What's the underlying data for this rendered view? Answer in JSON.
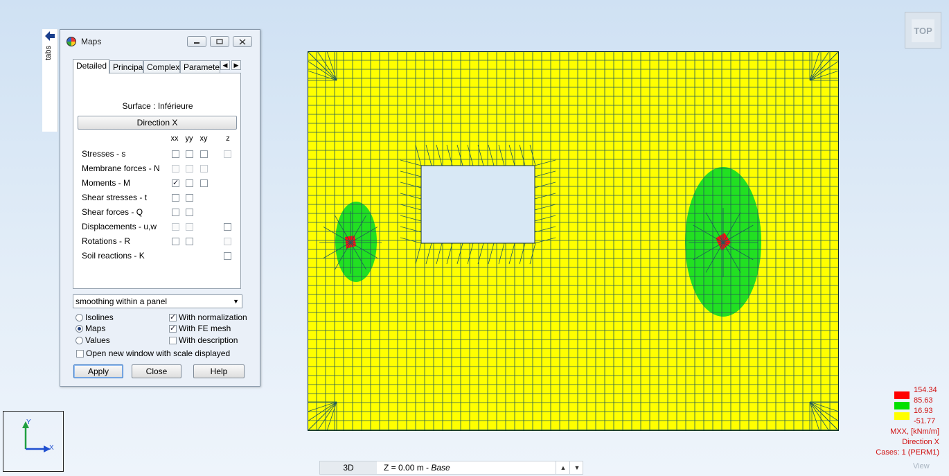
{
  "tabs_strip": {
    "label": "tabs"
  },
  "dialog": {
    "title": "Maps",
    "tabs": [
      {
        "label": "Detailed",
        "active": true
      },
      {
        "label": "Principal",
        "active": false
      },
      {
        "label": "Complex",
        "active": false
      },
      {
        "label": "Parameter",
        "active": false
      }
    ],
    "surface_label": "Surface : Inférieure",
    "direction_button": "Direction X",
    "columns": [
      "xx",
      "yy",
      "xy",
      "z"
    ],
    "rows": [
      {
        "label": "Stresses - s",
        "xx": "off",
        "yy": "off",
        "xy": "off",
        "z": "disabled"
      },
      {
        "label": "Membrane forces - N",
        "xx": "disabled",
        "yy": "disabled",
        "xy": "disabled",
        "z": "none"
      },
      {
        "label": "Moments - M",
        "xx": "checked",
        "yy": "off",
        "xy": "off",
        "z": "none"
      },
      {
        "label": "Shear stresses - t",
        "xx": "off",
        "yy": "off",
        "xy": "none",
        "z": "none"
      },
      {
        "label": "Shear forces - Q",
        "xx": "off",
        "yy": "off",
        "xy": "none",
        "z": "none"
      },
      {
        "label": "Displacements - u,w",
        "xx": "disabled",
        "yy": "disabled",
        "xy": "none",
        "z": "off"
      },
      {
        "label": "Rotations - R",
        "xx": "off",
        "yy": "off",
        "xy": "none",
        "z": "disabled"
      },
      {
        "label": "Soil reactions - K",
        "xx": "none",
        "yy": "none",
        "xy": "none",
        "z": "off"
      }
    ],
    "smoothing_value": "smoothing within a panel",
    "display_modes": [
      {
        "label": "Isolines",
        "selected": false
      },
      {
        "label": "Maps",
        "selected": true
      },
      {
        "label": "Values",
        "selected": false
      }
    ],
    "options": [
      {
        "label": "With normalization",
        "checked": true
      },
      {
        "label": "With FE mesh",
        "checked": true
      },
      {
        "label": "With description",
        "checked": false
      }
    ],
    "open_new_window": {
      "label": "Open new window with scale displayed",
      "checked": false
    },
    "buttons": {
      "apply": "Apply",
      "close": "Close",
      "help": "Help"
    }
  },
  "view_cube": {
    "label": "TOP"
  },
  "axis": {
    "x": "X",
    "y": "Y"
  },
  "legend": {
    "values": [
      "154.34",
      "85.63",
      "16.93",
      "-51.77"
    ],
    "colors": [
      "#ff0000",
      "#00e000",
      "#ffff00",
      "#ffff00"
    ],
    "quantity": "MXX, [kNm/m]",
    "direction": "Direction X",
    "cases": "Cases: 1 (PERM1)"
  },
  "bottom_bar": {
    "mode": "3D",
    "z_prefix": "Z = 0.00 m - ",
    "z_name": "Base"
  },
  "view_label": "View",
  "map_colors": {
    "base": "#ffff00",
    "mid": "#22e022",
    "peak": "#ff1010",
    "mesh": "#1f5a5a",
    "hole": "#d8e8f5"
  }
}
